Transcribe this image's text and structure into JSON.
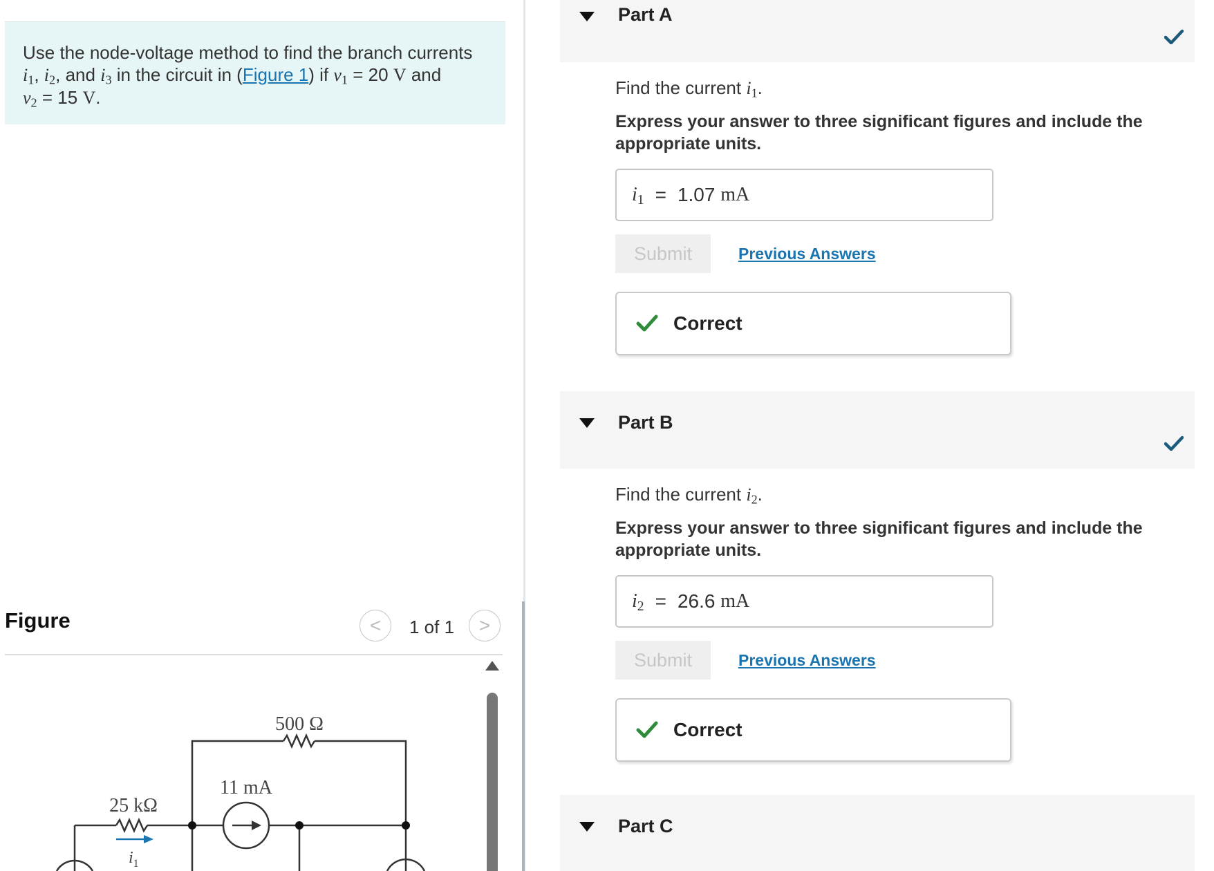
{
  "problem": {
    "text_1": "Use the node-voltage method to find the branch currents",
    "var_i": "i",
    "sub_1": "1",
    "sub_2": "2",
    "sub_3": "3",
    "comma": ",",
    "and": "and",
    "in_the_circuit_in": "in the circuit in (",
    "figure_link": "Figure 1",
    "if": ") if",
    "var_v": "v",
    "equals_20": "= 20",
    "unit_V": "V",
    "equals_15": "= 15",
    "period": "."
  },
  "figure": {
    "title": "Figure",
    "pager": "1 of 1",
    "prev_glyph": "<",
    "next_glyph": ">",
    "labels": {
      "r_top": "500 Ω",
      "source": "11 mA",
      "r_left": "25 kΩ",
      "current_var": "i",
      "current_sub": "1"
    }
  },
  "parts": [
    {
      "label": "Part A",
      "question_prefix": "Find the current",
      "var": "i",
      "sub": "1",
      "period": ".",
      "instruction": "Express your answer to three significant figures and include the appropriate units.",
      "answer_value": "1.07",
      "answer_unit": "mA",
      "equals": "=",
      "submit": "Submit",
      "previous_answers": "Previous Answers",
      "feedback": "Correct"
    },
    {
      "label": "Part B",
      "question_prefix": "Find the current",
      "var": "i",
      "sub": "2",
      "period": ".",
      "instruction": "Express your answer to three significant figures and include the appropriate units.",
      "answer_value": "26.6",
      "answer_unit": "mA",
      "equals": "=",
      "submit": "Submit",
      "previous_answers": "Previous Answers",
      "feedback": "Correct"
    },
    {
      "label": "Part C"
    }
  ],
  "colors": {
    "problem_bg": "#e6f5f5",
    "link": "#1a74b0",
    "check_blue": "#1b5a7a",
    "check_green": "#2e8b3a",
    "part_header_bg": "#f5f5f5"
  }
}
